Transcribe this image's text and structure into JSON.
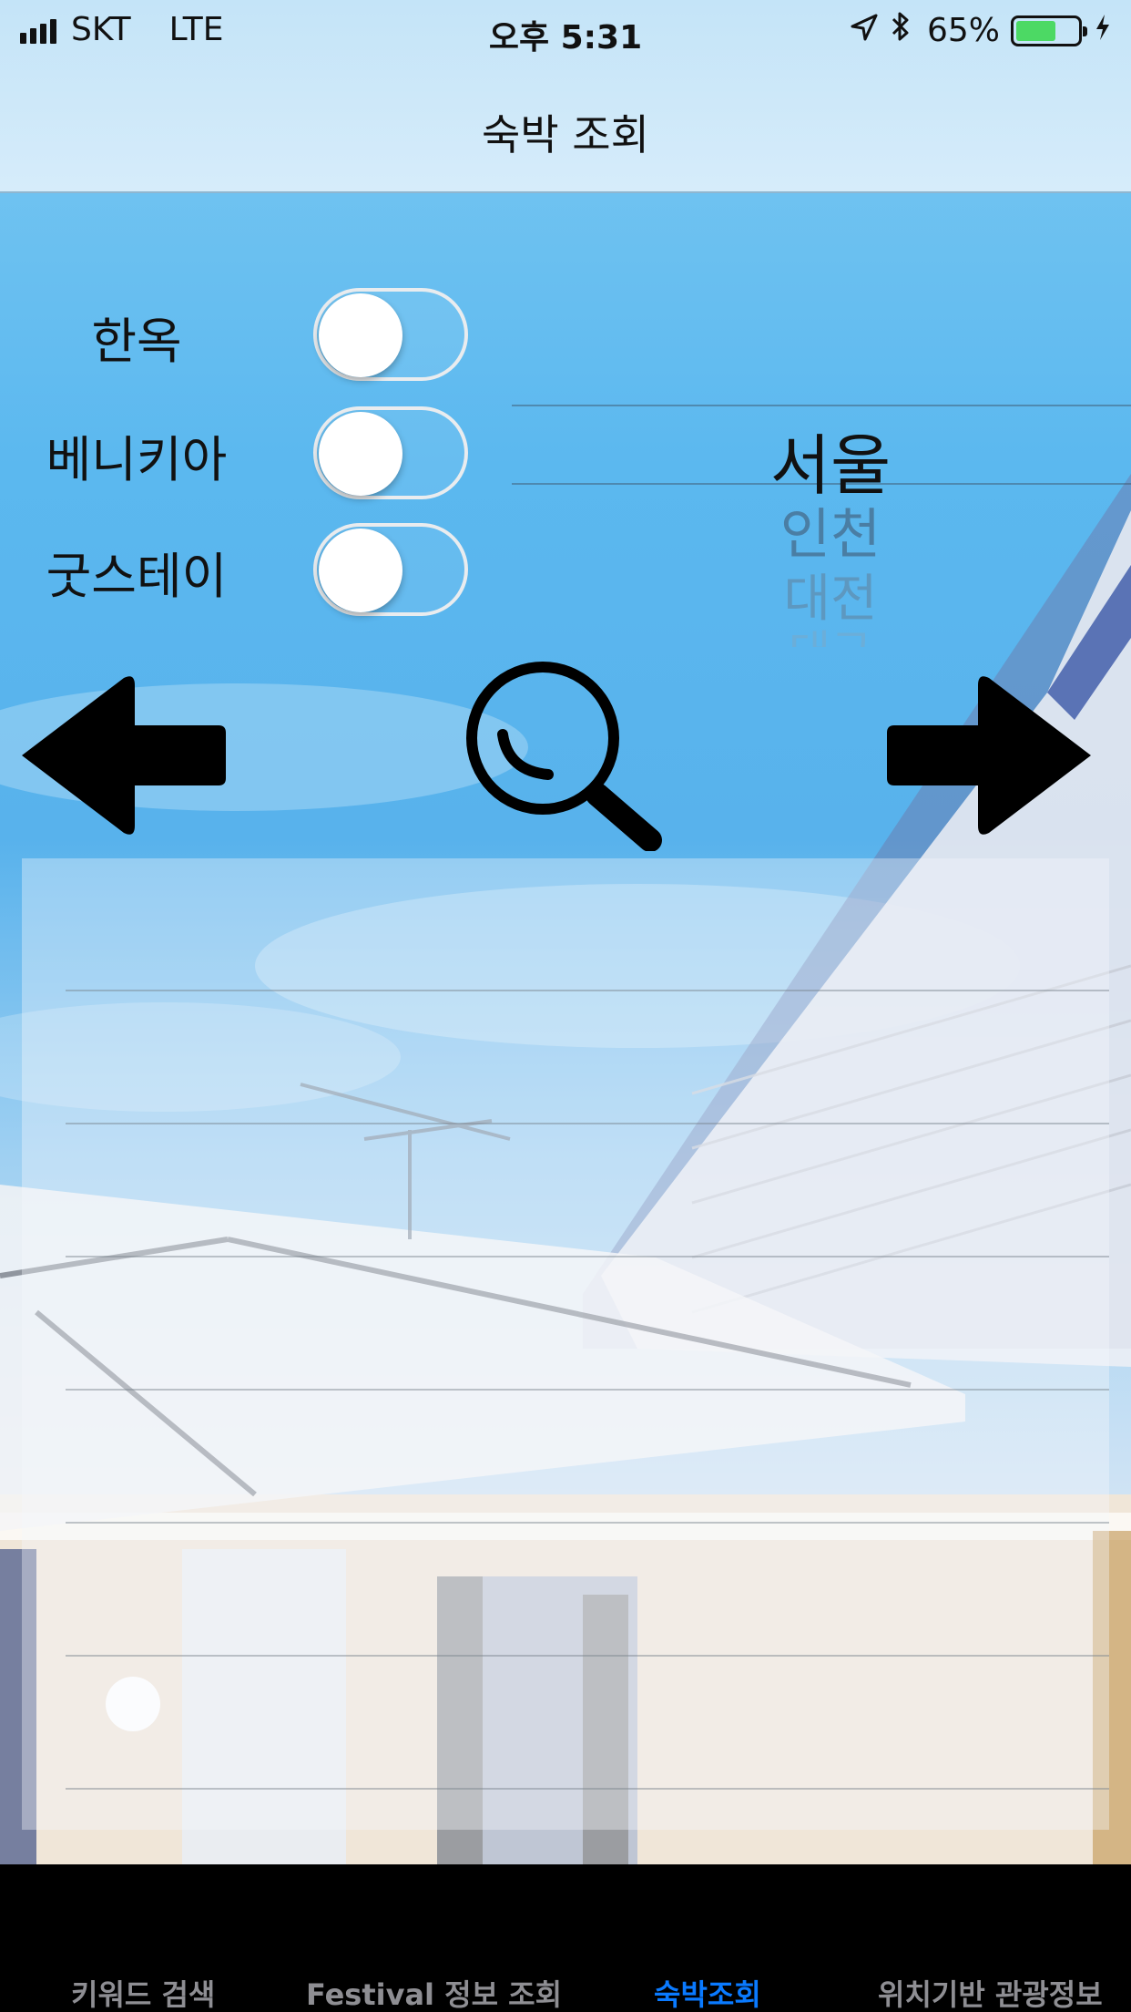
{
  "status_bar": {
    "carrier": "SKT",
    "network": "LTE",
    "time": "오후 5:31",
    "battery": "65%",
    "location_icon": "location-arrow-icon",
    "bluetooth_icon": "bluetooth-icon",
    "charging_icon": "bolt-icon"
  },
  "nav": {
    "title": "숙박 조회"
  },
  "toggles": [
    {
      "label": "한옥",
      "on": false
    },
    {
      "label": "베니키아",
      "on": false
    },
    {
      "label": "굿스테이",
      "on": false
    }
  ],
  "picker": {
    "selected": "서울",
    "items": [
      "인천",
      "대전",
      "대구"
    ]
  },
  "controls": {
    "prev_icon": "arrow-left-icon",
    "search_icon": "magnifier-icon",
    "next_icon": "arrow-right-icon"
  },
  "results": {
    "rows": [
      "",
      "",
      "",
      "",
      "",
      "",
      ""
    ]
  },
  "tabs": [
    {
      "label": "키워드 검색",
      "active": false
    },
    {
      "label": "Festival 정보 조회",
      "active": false
    },
    {
      "label": "숙박조회",
      "active": true
    },
    {
      "label": "위치기반 관광정보",
      "active": false
    }
  ],
  "colors": {
    "accent": "#0a7aff",
    "battery": "#4cd964",
    "tab_inactive": "#8e8e93"
  }
}
